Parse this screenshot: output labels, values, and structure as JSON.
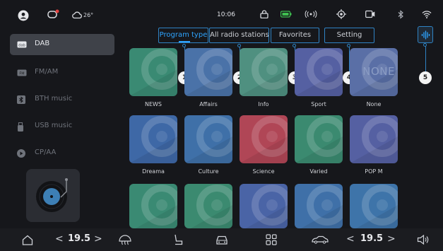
{
  "status_bar": {
    "weather_temp": "26°",
    "clock": "10:06"
  },
  "sidebar": {
    "items": [
      {
        "label": "DAB",
        "icon": "dab-icon",
        "active": true
      },
      {
        "label": "FM/AM",
        "icon": "fm-icon",
        "active": false
      },
      {
        "label": "BTH music",
        "icon": "bluetooth-icon",
        "active": false
      },
      {
        "label": "USB music",
        "icon": "usb-icon",
        "active": false
      },
      {
        "label": "CP/AA",
        "icon": "carplay-icon",
        "active": false
      }
    ],
    "album_card_icon": "vinyl-record-icon"
  },
  "tabs": [
    {
      "label": "Program type",
      "marker": "1",
      "active": true
    },
    {
      "label": "All radio stations",
      "marker": "2",
      "active": false
    },
    {
      "label": "Favorites",
      "marker": "3",
      "active": false
    },
    {
      "label": "Setting",
      "marker": "4",
      "active": false
    }
  ],
  "eq_button": {
    "icon": "equalizer-icon",
    "marker": "5"
  },
  "tiles": [
    {
      "label": "NEWS",
      "color": "#3a8a73"
    },
    {
      "label": "Affairs",
      "color": "#4a72a8"
    },
    {
      "label": "Info",
      "color": "#4f9080"
    },
    {
      "label": "Sport",
      "color": "#5560a2"
    },
    {
      "label": "None",
      "color": "#5a6fa6",
      "overlay_text": "NONE"
    },
    {
      "label": "Dreama",
      "color": "#3e68a6"
    },
    {
      "label": "Culture",
      "color": "#3f70a8"
    },
    {
      "label": "Science",
      "color": "#b04656"
    },
    {
      "label": "Varied",
      "color": "#3b8a70"
    },
    {
      "label": "POP M",
      "color": "#5560a2"
    },
    {
      "label": "",
      "color": "#3a8a73"
    },
    {
      "label": "",
      "color": "#3b8a70"
    },
    {
      "label": "",
      "color": "#4a64a6"
    },
    {
      "label": "",
      "color": "#3f70a8"
    },
    {
      "label": "",
      "color": "#3e74a9"
    }
  ],
  "bottom_bar": {
    "left_temp": "19.5",
    "right_temp": "19.5",
    "chevron_left": "<",
    "chevron_right": ">"
  }
}
